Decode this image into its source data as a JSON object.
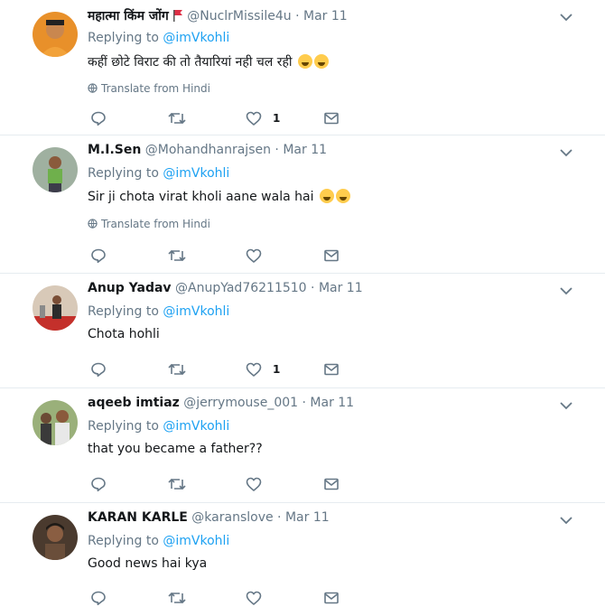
{
  "tweets": [
    {
      "name": "महात्मा किंम जोंग",
      "handle": "@NuclrMissile4u",
      "date": "Mar 11",
      "replying_label": "Replying to",
      "mention": "@imVkohli",
      "text": "कहीं छोटे विराट की तो तैयारियां नही चल रही",
      "translate": "Translate from Hindi",
      "like_count": "1"
    },
    {
      "name": "M.I.Sen",
      "handle": "@Mohandhanrajsen",
      "date": "Mar 11",
      "replying_label": "Replying to",
      "mention": "@imVkohli",
      "text": "Sir ji chota virat kholi aane wala hai",
      "translate": "Translate from Hindi",
      "like_count": ""
    },
    {
      "name": "Anup Yadav",
      "handle": "@AnupYad76211510",
      "date": "Mar 11",
      "replying_label": "Replying to",
      "mention": "@imVkohli",
      "text": "Chota hohli",
      "like_count": "1"
    },
    {
      "name": "aqeeb imtiaz",
      "handle": "@jerrymouse_001",
      "date": "Mar 11",
      "replying_label": "Replying to",
      "mention": "@imVkohli",
      "text": "that you became a father??",
      "like_count": ""
    },
    {
      "name": "KARAN KARLE",
      "handle": "@karanslove",
      "date": "Mar 11",
      "replying_label": "Replying to",
      "mention": "@imVkohli",
      "text": "Good news hai kya",
      "like_count": ""
    }
  ],
  "colors": {
    "link": "#1da1f2",
    "muted": "#657786",
    "text": "#14171a",
    "divider": "#e6ecf0"
  },
  "icons": [
    "reply-icon",
    "retweet-icon",
    "like-icon",
    "message-icon",
    "caret-down-icon",
    "globe-icon",
    "flag-icon"
  ]
}
